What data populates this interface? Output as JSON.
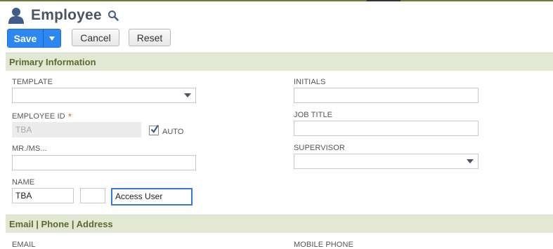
{
  "header": {
    "title": "Employee",
    "person_icon": "person-icon",
    "search_icon": "search-icon"
  },
  "toolbar": {
    "save_label": "Save",
    "save_dropdown_icon": "caret-down-icon",
    "cancel_label": "Cancel",
    "reset_label": "Reset"
  },
  "sections": {
    "primary": "Primary Information",
    "email": "Email | Phone | Address"
  },
  "fields": {
    "template": {
      "label": "TEMPLATE",
      "value": ""
    },
    "employee_id": {
      "label": "EMPLOYEE ID",
      "required_mark": "*",
      "value": "TBA",
      "auto_label": "AUTO",
      "auto_checked": true
    },
    "mr_ms": {
      "label": "MR./MS...",
      "value": ""
    },
    "name": {
      "label": "NAME",
      "first": "TBA",
      "middle": "",
      "last": "Access User"
    },
    "initials": {
      "label": "INITIALS",
      "value": ""
    },
    "job_title": {
      "label": "JOB TITLE",
      "value": ""
    },
    "supervisor": {
      "label": "SUPERVISOR",
      "value": ""
    },
    "email": {
      "label": "EMAIL"
    },
    "mobile_phone": {
      "label": "MOBILE PHONE"
    }
  },
  "colors": {
    "accent": "#2d87f0",
    "section_bg": "#e3e8d4",
    "section_text": "#5c6a2c",
    "required": "#e07b1a"
  }
}
